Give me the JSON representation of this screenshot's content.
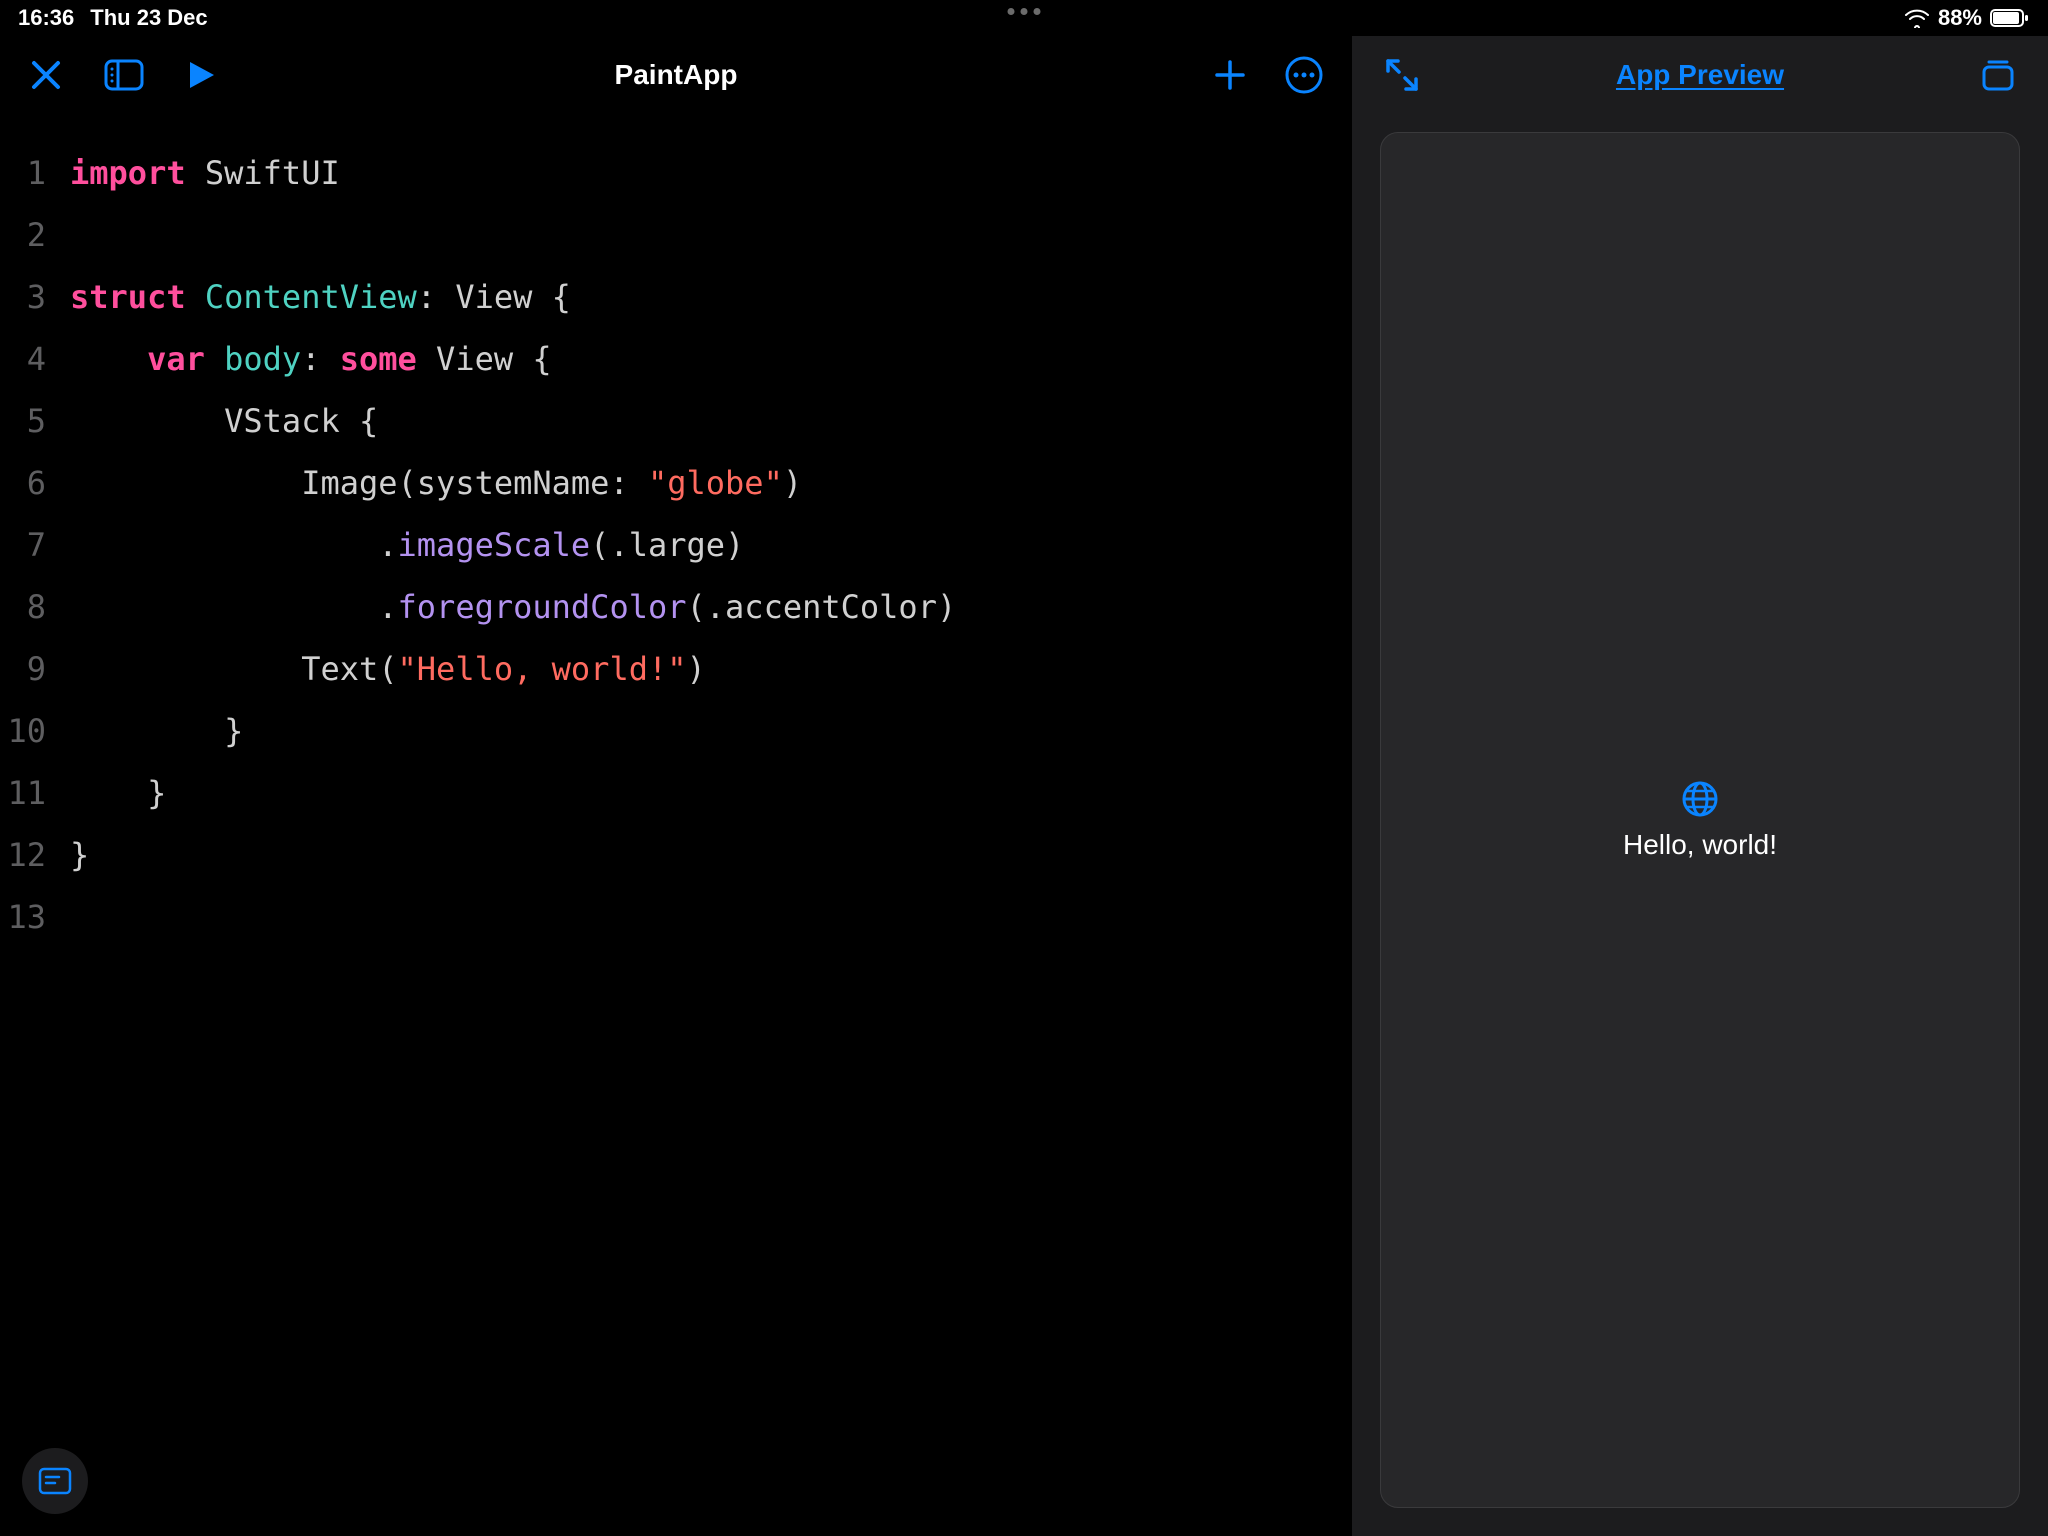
{
  "status": {
    "time": "16:36",
    "date": "Thu 23 Dec",
    "battery_pct": "88%"
  },
  "editor": {
    "title": "PaintApp",
    "lines": [
      {
        "n": "1",
        "segs": [
          [
            "kw-pink",
            "import"
          ],
          [
            "ident",
            " "
          ],
          [
            "ident",
            "SwiftUI"
          ]
        ]
      },
      {
        "n": "2",
        "segs": []
      },
      {
        "n": "3",
        "segs": [
          [
            "kw-pink",
            "struct"
          ],
          [
            "ident",
            " "
          ],
          [
            "typ-teal",
            "ContentView"
          ],
          [
            "punct",
            ": "
          ],
          [
            "ident",
            "View"
          ],
          [
            "punct",
            " {"
          ]
        ]
      },
      {
        "n": "4",
        "segs": [
          [
            "ident",
            "    "
          ],
          [
            "kw-pink",
            "var"
          ],
          [
            "ident",
            " "
          ],
          [
            "typ-teal",
            "body"
          ],
          [
            "punct",
            ": "
          ],
          [
            "kw-pink",
            "some"
          ],
          [
            "ident",
            " "
          ],
          [
            "ident",
            "View"
          ],
          [
            "punct",
            " {"
          ]
        ]
      },
      {
        "n": "5",
        "segs": [
          [
            "ident",
            "        "
          ],
          [
            "ident",
            "VStack"
          ],
          [
            "punct",
            " {"
          ]
        ]
      },
      {
        "n": "6",
        "segs": [
          [
            "ident",
            "            "
          ],
          [
            "ident",
            "Image"
          ],
          [
            "punct",
            "("
          ],
          [
            "ident",
            "systemName"
          ],
          [
            "punct",
            ": "
          ],
          [
            "str",
            "\"globe\""
          ],
          [
            "punct",
            ")"
          ]
        ]
      },
      {
        "n": "7",
        "segs": [
          [
            "ident",
            "                "
          ],
          [
            "punct",
            "."
          ],
          [
            "method-violet",
            "imageScale"
          ],
          [
            "punct",
            "(."
          ],
          [
            "ident",
            "large"
          ],
          [
            "punct",
            ")"
          ]
        ]
      },
      {
        "n": "8",
        "segs": [
          [
            "ident",
            "                "
          ],
          [
            "punct",
            "."
          ],
          [
            "method-violet",
            "foregroundColor"
          ],
          [
            "punct",
            "(."
          ],
          [
            "ident",
            "accentColor"
          ],
          [
            "punct",
            ")"
          ]
        ]
      },
      {
        "n": "9",
        "segs": [
          [
            "ident",
            "            "
          ],
          [
            "ident",
            "Text"
          ],
          [
            "punct",
            "("
          ],
          [
            "str",
            "\"Hello, world!\""
          ],
          [
            "punct",
            ")"
          ]
        ]
      },
      {
        "n": "10",
        "segs": [
          [
            "ident",
            "        "
          ],
          [
            "punct",
            "}"
          ]
        ]
      },
      {
        "n": "11",
        "segs": [
          [
            "ident",
            "    "
          ],
          [
            "punct",
            "}"
          ]
        ]
      },
      {
        "n": "12",
        "segs": [
          [
            "punct",
            "}"
          ]
        ]
      },
      {
        "n": "13",
        "segs": []
      }
    ]
  },
  "preview": {
    "title": "App Preview",
    "content_text": "Hello, world!"
  },
  "colors": {
    "accent": "#0a84ff",
    "bg_editor": "#000000",
    "bg_sidebar": "#1c1c1e",
    "bg_canvas": "#272729"
  }
}
